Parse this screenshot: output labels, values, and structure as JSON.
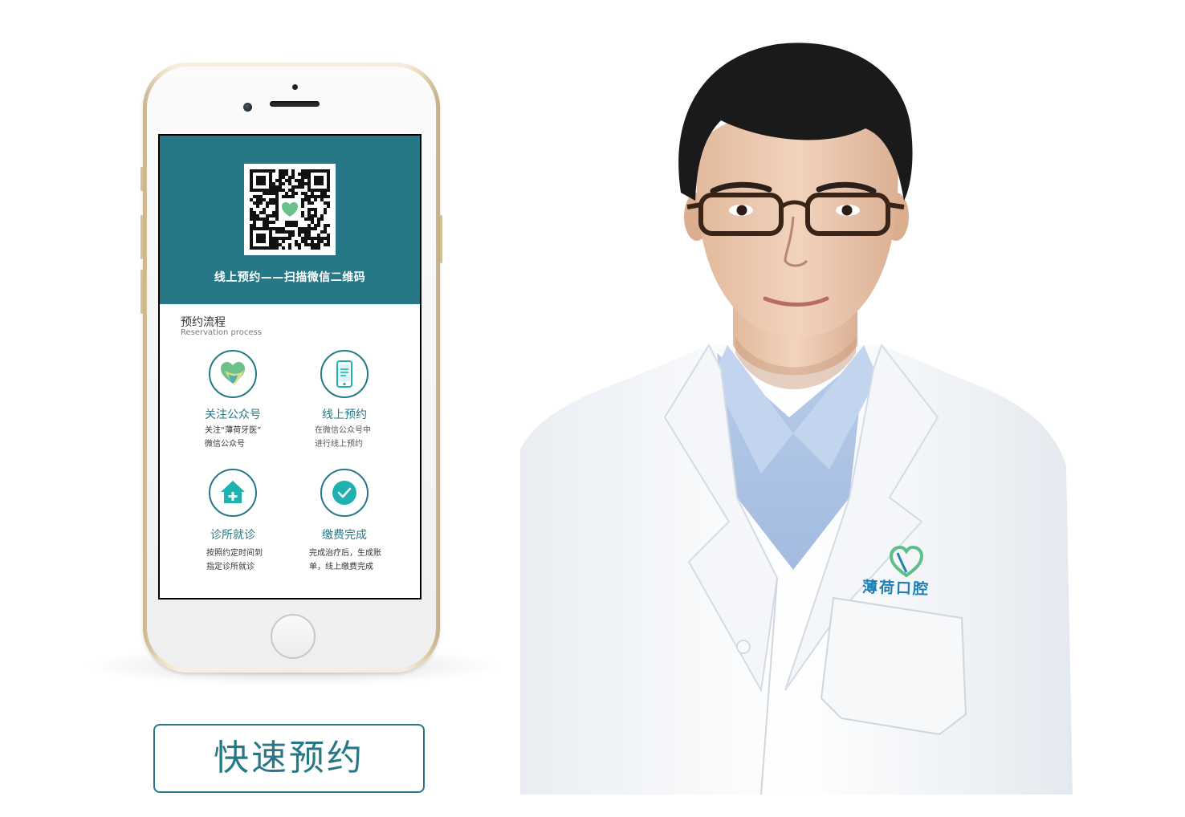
{
  "phone_screen": {
    "banner_text": "线上预约——扫描微信二维码",
    "process_title": "预约流程",
    "process_subtitle": "Reservation process",
    "steps": [
      {
        "icon": "tooth-heart-icon",
        "title": "关注公众号",
        "desc_line1": "关注“薄荷牙医”",
        "desc_line2": "微信公众号"
      },
      {
        "icon": "mobile-phone-icon",
        "title": "线上预约",
        "desc_line1": "在微信公众号中",
        "desc_line2": "进行线上预约"
      },
      {
        "icon": "clinic-house-icon",
        "title": "诊所就诊",
        "desc_line1": "按照约定时间到",
        "desc_line2": "指定诊所就诊"
      },
      {
        "icon": "check-circle-icon",
        "title": "缴费完成",
        "desc_line1": "完成治疗后，生成账",
        "desc_line2": "单，线上缴费完成"
      }
    ]
  },
  "quick_button": {
    "label": "快速预约"
  },
  "doctor": {
    "coat_logo_text": "薄荷口腔"
  },
  "colors": {
    "accent": "#277886",
    "coat_logo": "#1f7fb5",
    "brand_green": "#5cbf8a"
  }
}
